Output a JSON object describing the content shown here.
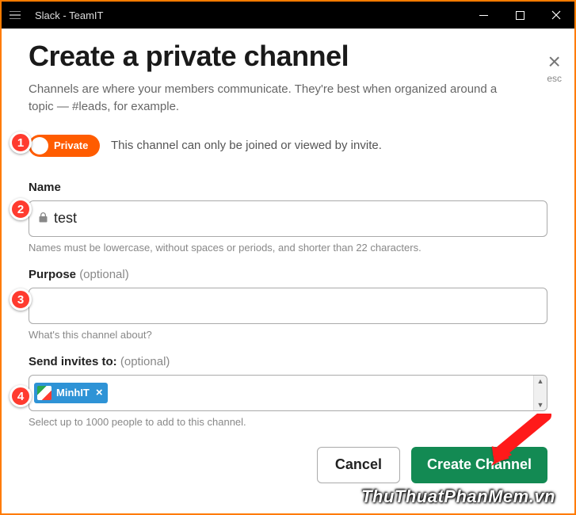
{
  "window": {
    "title": "Slack - TeamIT"
  },
  "modal": {
    "title": "Create a private channel",
    "description": "Channels are where your members communicate. They're best when organized around a topic — #leads, for example.",
    "close_label": "esc"
  },
  "toggle": {
    "label": "Private",
    "on": true,
    "hint": "This channel can only be joined or viewed by invite."
  },
  "fields": {
    "name": {
      "label": "Name",
      "value": "test",
      "help": "Names must be lowercase, without spaces or periods, and shorter than 22 characters."
    },
    "purpose": {
      "label": "Purpose",
      "optional_suffix": "(optional)",
      "value": "",
      "help": "What's this channel about?"
    },
    "invites": {
      "label": "Send invites to:",
      "optional_suffix": "(optional)",
      "chips": [
        {
          "name": "MinhIT"
        }
      ],
      "help": "Select up to 1000 people to add to this channel."
    }
  },
  "buttons": {
    "cancel": "Cancel",
    "create": "Create Channel"
  },
  "callouts": [
    "1",
    "2",
    "3",
    "4"
  ],
  "watermark": "ThuThuatPhanMem.vn"
}
